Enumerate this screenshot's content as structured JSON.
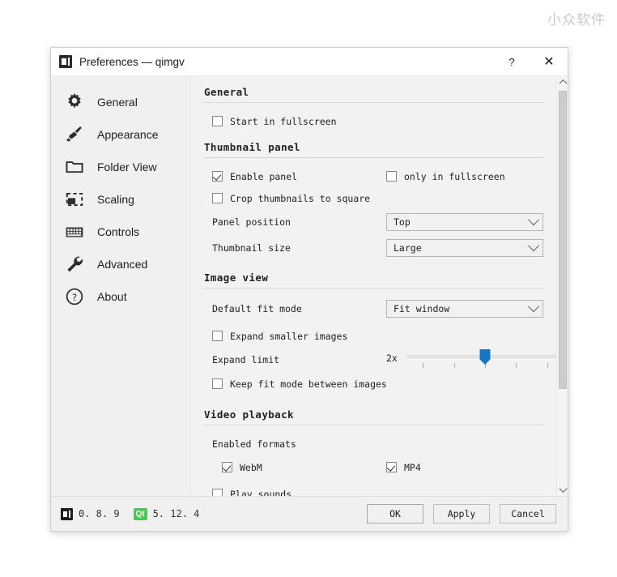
{
  "watermark": "小众软件",
  "window": {
    "title": "Preferences — qimgv",
    "app_icon": "app-window-icon",
    "help_label": "?",
    "close_label": "✕"
  },
  "sidebar": {
    "items": [
      {
        "label": "General",
        "icon": "gear-icon"
      },
      {
        "label": "Appearance",
        "icon": "paintbrush-icon"
      },
      {
        "label": "Folder View",
        "icon": "folder-icon"
      },
      {
        "label": "Scaling",
        "icon": "scaling-icon"
      },
      {
        "label": "Controls",
        "icon": "keyboard-icon"
      },
      {
        "label": "Advanced",
        "icon": "wrench-icon"
      },
      {
        "label": "About",
        "icon": "question-circle-icon"
      }
    ]
  },
  "sections": {
    "general": {
      "title": "General",
      "start_fullscreen": {
        "label": "Start in fullscreen",
        "checked": false
      }
    },
    "thumbnail_panel": {
      "title": "Thumbnail panel",
      "enable_panel": {
        "label": "Enable panel",
        "checked": true
      },
      "only_in_fullscreen": {
        "label": "only in fullscreen",
        "checked": false
      },
      "crop_square": {
        "label": "Crop thumbnails to square",
        "checked": false
      },
      "panel_position": {
        "label": "Panel position",
        "value": "Top"
      },
      "thumbnail_size": {
        "label": "Thumbnail size",
        "value": "Large"
      }
    },
    "image_view": {
      "title": "Image view",
      "default_fit_mode": {
        "label": "Default fit mode",
        "value": "Fit window"
      },
      "expand_smaller": {
        "label": "Expand smaller images",
        "checked": false
      },
      "expand_limit": {
        "label": "Expand limit",
        "value": "2x",
        "ticks": 5,
        "position": 3
      },
      "keep_fit_mode": {
        "label": "Keep fit mode between images",
        "checked": false
      }
    },
    "video_playback": {
      "title": "Video playback",
      "enabled_formats_label": "Enabled formats",
      "webm": {
        "label": "WebM",
        "checked": true
      },
      "mp4": {
        "label": "MP4",
        "checked": true
      },
      "play_sounds": {
        "label": "Play sounds",
        "checked": false
      }
    }
  },
  "footer": {
    "app_version": "0. 8. 9",
    "qt_badge": "Qt",
    "qt_version": "5. 12. 4",
    "ok_label": "OK",
    "apply_label": "Apply",
    "cancel_label": "Cancel"
  },
  "colors": {
    "accent": "#1575c6",
    "qt_green": "#41cd52",
    "window_bg": "#f0f0f0",
    "content_bg": "#f2f2f2"
  }
}
